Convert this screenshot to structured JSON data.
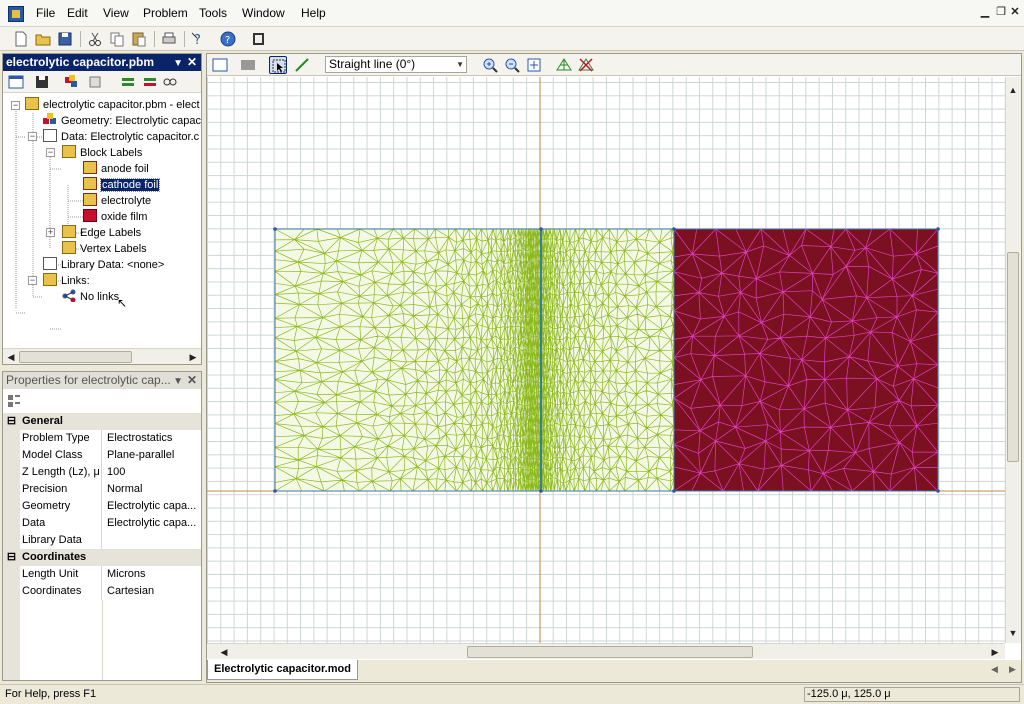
{
  "menubar": {
    "items": [
      "File",
      "Edit",
      "View",
      "Problem",
      "Tools",
      "Window",
      "Help"
    ]
  },
  "tree_panel": {
    "title": "electrolytic capacitor.pbm",
    "nodes": {
      "root": "electrolytic capacitor.pbm - elect",
      "geometry": "Geometry: Electrolytic capac",
      "data": "Data: Electrolytic capacitor.c",
      "block_labels": "Block Labels",
      "anode_foil": "anode foil",
      "cathode_foil": "cathode foil",
      "electrolyte": "electrolyte",
      "oxide_film": "oxide film",
      "edge_labels": "Edge Labels",
      "vertex_labels": "Vertex Labels",
      "library_data": "Library Data: <none>",
      "links": "Links:",
      "no_links": "No links"
    }
  },
  "props_panel": {
    "title": "Properties for electrolytic cap...",
    "categories": {
      "general": "General",
      "coordinates": "Coordinates"
    },
    "general_rows": [
      {
        "key": "Problem Type",
        "value": "Electrostatics"
      },
      {
        "key": "Model Class",
        "value": "Plane-parallel"
      },
      {
        "key": "Z Length (Lz), μ",
        "value": "100"
      },
      {
        "key": "Precision",
        "value": "Normal"
      },
      {
        "key": "Geometry",
        "value": "Electrolytic capa..."
      },
      {
        "key": "Data",
        "value": "Electrolytic capa..."
      },
      {
        "key": "Library Data",
        "value": ""
      }
    ],
    "coord_rows": [
      {
        "key": "Length Unit",
        "value": "Microns"
      },
      {
        "key": "Coordinates",
        "value": "Cartesian"
      }
    ]
  },
  "view_toolbar": {
    "mode_select": "Straight line (0°)"
  },
  "document": {
    "tab_label": "Electrolytic capacitor.mod"
  },
  "status": {
    "help_text": "For Help, press F1",
    "coordinates": "-125.0 μ, 125.0 μ"
  },
  "colors": {
    "mesh_green": "#8cb81c",
    "conductor_maroon": "#7a1020",
    "mesh_magenta": "#e040c0",
    "axis_orange": "#c8864a",
    "title_blue": "#0a246a"
  },
  "icons": [
    "app-icon",
    "new-icon",
    "open-icon",
    "save-icon",
    "cut-icon",
    "copy-icon",
    "paste-icon",
    "print-icon",
    "context-help-icon",
    "help-icon",
    "book-icon",
    "select-icon",
    "zoom-in-icon",
    "zoom-out-icon",
    "zoom-fit-icon",
    "mesh-icon",
    "remove-mesh-icon"
  ]
}
